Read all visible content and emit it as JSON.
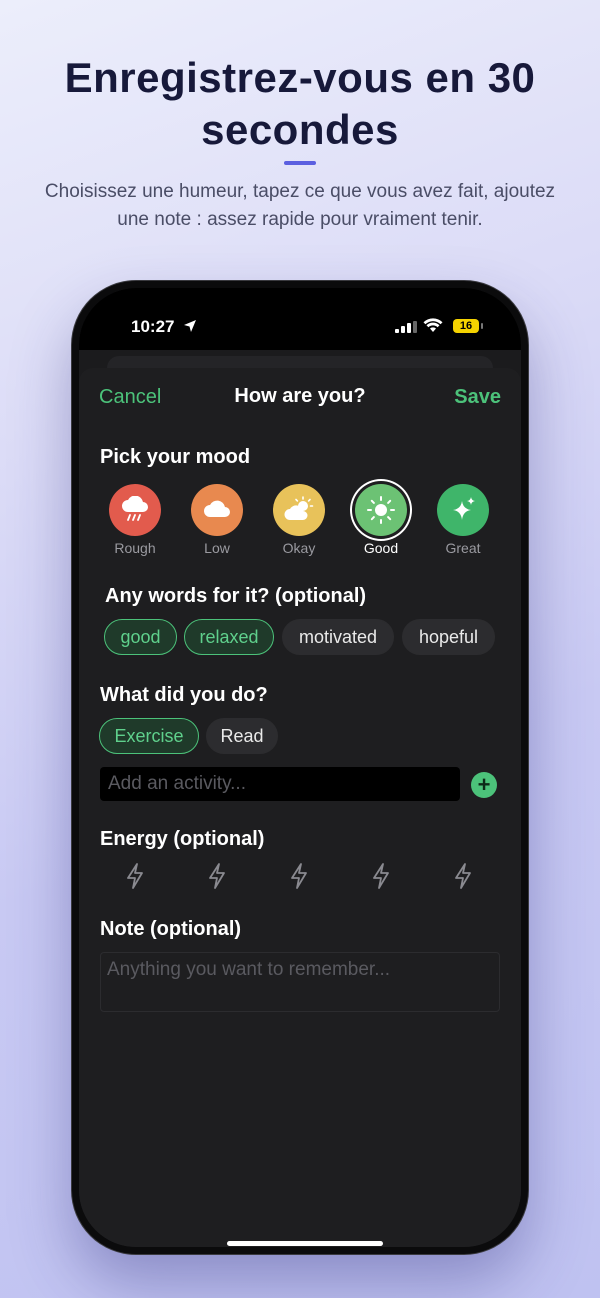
{
  "headline": "Enregistrez-vous en 30 secondes",
  "subtitle": "Choisissez une humeur, tapez ce que vous avez fait, ajoutez une note : assez rapide pour vraiment tenir.",
  "status_bar": {
    "time": "10:27",
    "battery": "16"
  },
  "nav": {
    "cancel": "Cancel",
    "title": "How are you?",
    "save": "Save"
  },
  "mood_section": {
    "title": "Pick your mood",
    "moods": [
      {
        "label": "Rough",
        "icon": "rain-cloud-icon",
        "color": "#e25b4d"
      },
      {
        "label": "Low",
        "icon": "cloud-icon",
        "color": "#e8894f"
      },
      {
        "label": "Okay",
        "icon": "sun-cloud-icon",
        "color": "#e8c25a"
      },
      {
        "label": "Good",
        "icon": "sun-icon",
        "color": "#6cc274",
        "selected": true
      },
      {
        "label": "Great",
        "icon": "sparkles-icon",
        "color": "#3fb56a"
      }
    ]
  },
  "words_section": {
    "title": "Any words for it? (optional)",
    "words": [
      {
        "label": "good",
        "selected": true
      },
      {
        "label": "relaxed",
        "selected": true
      },
      {
        "label": "motivated",
        "selected": false
      },
      {
        "label": "hopeful",
        "selected": false
      }
    ]
  },
  "activity_section": {
    "title": "What did you do?",
    "activities": [
      {
        "label": "Exercise",
        "selected": true
      },
      {
        "label": "Read",
        "selected": false
      }
    ],
    "input_placeholder": "Add an activity...",
    "add_label": "+"
  },
  "energy_section": {
    "title": "Energy (optional)",
    "level": 0,
    "max": 5
  },
  "note_section": {
    "title": "Note (optional)",
    "placeholder": "Anything you want to remember..."
  },
  "colors": {
    "accent": "#4cc27a",
    "headline": "#17193a",
    "sheet": "#1e1e20"
  }
}
